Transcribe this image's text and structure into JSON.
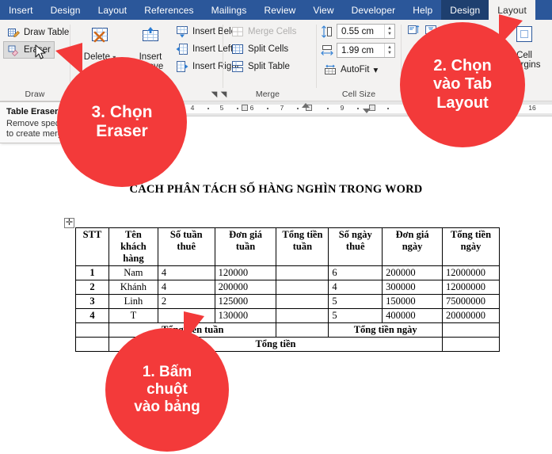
{
  "tabs": [
    {
      "label": "Insert",
      "state": "normal"
    },
    {
      "label": "Design",
      "state": "normal"
    },
    {
      "label": "Layout",
      "state": "normal"
    },
    {
      "label": "References",
      "state": "normal"
    },
    {
      "label": "Mailings",
      "state": "normal"
    },
    {
      "label": "Review",
      "state": "normal"
    },
    {
      "label": "View",
      "state": "normal"
    },
    {
      "label": "Developer",
      "state": "normal"
    },
    {
      "label": "Help",
      "state": "normal"
    },
    {
      "label": "Design",
      "state": "contextual"
    },
    {
      "label": "Layout",
      "state": "active"
    }
  ],
  "ribbon": {
    "draw_group": {
      "label": "Draw",
      "draw_table": "Draw Table",
      "eraser": "Eraser"
    },
    "rows_columns_group": {
      "delete": "Delete",
      "insert_above": "Insert Above",
      "insert_below": "Insert Below",
      "insert_left": "Insert Left",
      "insert_right": "Insert Right"
    },
    "merge_group": {
      "label": "Merge",
      "merge_cells": "Merge Cells",
      "split_cells": "Split Cells",
      "split_table": "Split Table"
    },
    "cell_size_group": {
      "label": "Cell Size",
      "height_value": "0.55 cm",
      "width_value": "1.99 cm",
      "autofit": "AutoFit"
    },
    "alignment_group": {
      "cell_margins_line1": "Cell",
      "cell_margins_line2": "Margins"
    }
  },
  "tooltip": {
    "title": "Table Eraser",
    "line1": "Remove specific lines",
    "line2": "to create merged cells."
  },
  "ruler": {
    "ticks": [
      "4",
      "5",
      "6",
      "7",
      "9",
      "16"
    ]
  },
  "document": {
    "title": "CÁCH PHÂN TÁCH SỐ HÀNG NGHÌN TRONG WORD",
    "table": {
      "headers": [
        "STT",
        "Tên khách hàng",
        "Số tuần thuê",
        "Đơn giá tuần",
        "Tổng tiền tuần",
        "Số ngày thuê",
        "Đơn giá ngày",
        "Tổng tiền ngày"
      ],
      "rows": [
        {
          "stt": "1",
          "ten": "Nam",
          "so_tuan": "4",
          "don_gia_tuan": "120000",
          "tong_tuan": "",
          "so_ngay": "6",
          "don_gia_ngay": "200000",
          "tong_ngay": "12000000"
        },
        {
          "stt": "2",
          "ten": "Khánh",
          "so_tuan": "4",
          "don_gia_tuan": "200000",
          "tong_tuan": "",
          "so_ngay": "4",
          "don_gia_ngay": "300000",
          "tong_ngay": "12000000"
        },
        {
          "stt": "3",
          "ten": "Linh",
          "so_tuan": "2",
          "don_gia_tuan": "125000",
          "tong_tuan": "",
          "so_ngay": "5",
          "don_gia_ngay": "150000",
          "tong_ngay": "75000000"
        },
        {
          "stt": "4",
          "ten": "T",
          "so_tuan": "",
          "don_gia_tuan": "130000",
          "tong_tuan": "",
          "so_ngay": "5",
          "don_gia_ngay": "400000",
          "tong_ngay": "20000000"
        }
      ],
      "summary_rows": [
        {
          "left_label": "Tổng tiền tuần",
          "right_label": "Tổng tiền ngày"
        },
        {
          "label": "Tổng tiền"
        }
      ]
    }
  },
  "callouts": [
    {
      "id": "1",
      "line1": "1. Bấm",
      "line2": "chuột",
      "line3": "vào bảng"
    },
    {
      "id": "2",
      "line1": "2. Chọn",
      "line2": "vào Tab",
      "line3": "Layout"
    },
    {
      "id": "3",
      "line1": "3. Chọn",
      "line2": "Eraser",
      "line3": ""
    }
  ],
  "colors": {
    "ribbon_blue": "#2B579A",
    "contextual_blue": "#1E3F6F",
    "bubble_red": "#F33A3A",
    "ribbon_bg": "#F3F2F1"
  }
}
